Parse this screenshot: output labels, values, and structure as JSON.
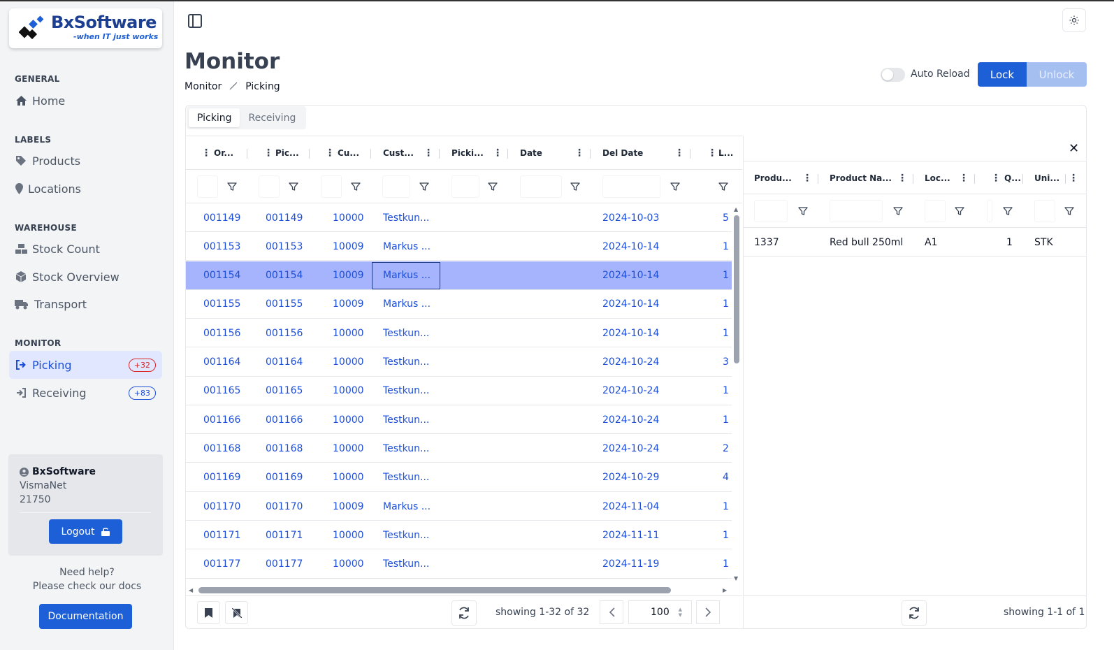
{
  "brand": {
    "name": "BxSoftware",
    "tagline": "-when IT just works"
  },
  "sidebar": {
    "sections": [
      {
        "title": "GENERAL",
        "items": [
          {
            "label": "Home",
            "icon": "home-icon"
          }
        ]
      },
      {
        "title": "LABELS",
        "items": [
          {
            "label": "Products",
            "icon": "tag-icon"
          },
          {
            "label": "Locations",
            "icon": "map-pin-icon"
          }
        ]
      },
      {
        "title": "WAREHOUSE",
        "items": [
          {
            "label": "Stock Count",
            "icon": "boxes-icon"
          },
          {
            "label": "Stock Overview",
            "icon": "cube-icon"
          },
          {
            "label": "Transport",
            "icon": "truck-icon"
          }
        ]
      },
      {
        "title": "MONITOR",
        "items": [
          {
            "label": "Picking",
            "icon": "sign-out-icon",
            "badge": "+32",
            "active": true
          },
          {
            "label": "Receiving",
            "icon": "sign-in-icon",
            "badge": "+83"
          }
        ]
      }
    ],
    "user": {
      "name": "BxSoftware",
      "system": "VismaNet",
      "company": "21750",
      "logout_label": "Logout"
    },
    "help": {
      "line1": "Need help?",
      "line2": "Please check our docs",
      "docs_label": "Documentation"
    }
  },
  "header": {
    "title": "Monitor",
    "breadcrumb": [
      "Monitor",
      "Picking"
    ],
    "auto_reload_label": "Auto Reload",
    "auto_reload_on": false,
    "lock_label": "Lock",
    "unlock_label": "Unlock"
  },
  "tabs": [
    {
      "label": "Picking",
      "active": true
    },
    {
      "label": "Receiving",
      "active": false
    }
  ],
  "orders_grid": {
    "columns": [
      "Or...",
      "Pic...",
      "Cu...",
      "Cust...",
      "Picki...",
      "Date",
      "Del Date",
      "L..."
    ],
    "rows": [
      [
        "001149",
        "001149",
        "10000",
        "Testkun...",
        "",
        "",
        "2024-10-03",
        "5"
      ],
      [
        "001153",
        "001153",
        "10009",
        "Markus ...",
        "",
        "",
        "2024-10-14",
        "1"
      ],
      [
        "001154",
        "001154",
        "10009",
        "Markus ...",
        "",
        "",
        "2024-10-14",
        "1"
      ],
      [
        "001155",
        "001155",
        "10009",
        "Markus ...",
        "",
        "",
        "2024-10-14",
        "1"
      ],
      [
        "001156",
        "001156",
        "10000",
        "Testkun...",
        "",
        "",
        "2024-10-14",
        "1"
      ],
      [
        "001164",
        "001164",
        "10000",
        "Testkun...",
        "",
        "",
        "2024-10-24",
        "3"
      ],
      [
        "001165",
        "001165",
        "10000",
        "Testkun...",
        "",
        "",
        "2024-10-24",
        "1"
      ],
      [
        "001166",
        "001166",
        "10000",
        "Testkun...",
        "",
        "",
        "2024-10-24",
        "1"
      ],
      [
        "001168",
        "001168",
        "10000",
        "Testkun...",
        "",
        "",
        "2024-10-24",
        "2"
      ],
      [
        "001169",
        "001169",
        "10000",
        "Testkun...",
        "",
        "",
        "2024-10-29",
        "4"
      ],
      [
        "001170",
        "001170",
        "10009",
        "Markus ...",
        "",
        "",
        "2024-11-04",
        "1"
      ],
      [
        "001171",
        "001171",
        "10000",
        "Testkun...",
        "",
        "",
        "2024-11-11",
        "1"
      ],
      [
        "001177",
        "001177",
        "10000",
        "Testkun...",
        "",
        "",
        "2024-11-19",
        "1"
      ]
    ],
    "selected_row": 2,
    "showing": "showing 1-32 of 32",
    "page_size": "100"
  },
  "detail_grid": {
    "columns": [
      "Produ...",
      "Product Na...",
      "Loc...",
      "Q...",
      "Uni..."
    ],
    "rows": [
      [
        "1337",
        "Red bull 250ml",
        "A1",
        "1",
        "STK"
      ]
    ],
    "showing": "showing 1-1 of 1"
  },
  "colors": {
    "accent": "#1d5fd6",
    "selected_row": "#a5b4fc",
    "link": "#1d4ed8",
    "badge_red": "#dc2626"
  }
}
